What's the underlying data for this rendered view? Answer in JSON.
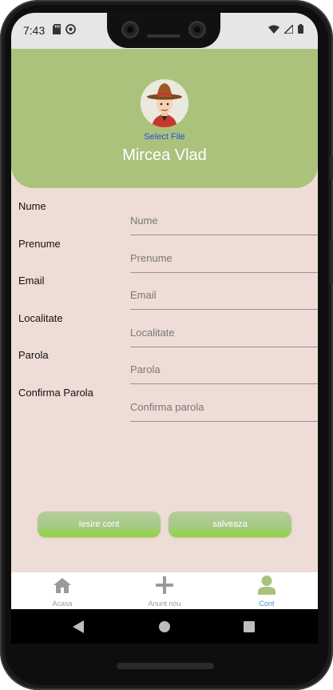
{
  "status_bar": {
    "time": "7:43"
  },
  "profile": {
    "select_file_label": "Select File",
    "name": "Mircea Vlad"
  },
  "form": {
    "fields": [
      {
        "label": "Nume",
        "placeholder": "Nume"
      },
      {
        "label": "Prenume",
        "placeholder": "Prenume"
      },
      {
        "label": "Email",
        "placeholder": "Email"
      },
      {
        "label": "Localitate",
        "placeholder": "Localitate"
      },
      {
        "label": "Parola",
        "placeholder": "Parola"
      },
      {
        "label": "Confirma Parola",
        "placeholder": "Confirma parola"
      }
    ]
  },
  "actions": {
    "logout_label": "Iesire cont",
    "save_label": "salveaza"
  },
  "bottom_nav": {
    "items": [
      {
        "label": "Acasa",
        "icon": "home-icon"
      },
      {
        "label": "Anunt nou",
        "icon": "plus-icon"
      },
      {
        "label": "Cont",
        "icon": "person-icon",
        "active": true
      }
    ]
  },
  "colors": {
    "header": "#abc27c",
    "background": "#eeddd6",
    "active": "#4a90d9",
    "inactive": "#9a9a9a",
    "link": "#2b4ed8"
  }
}
